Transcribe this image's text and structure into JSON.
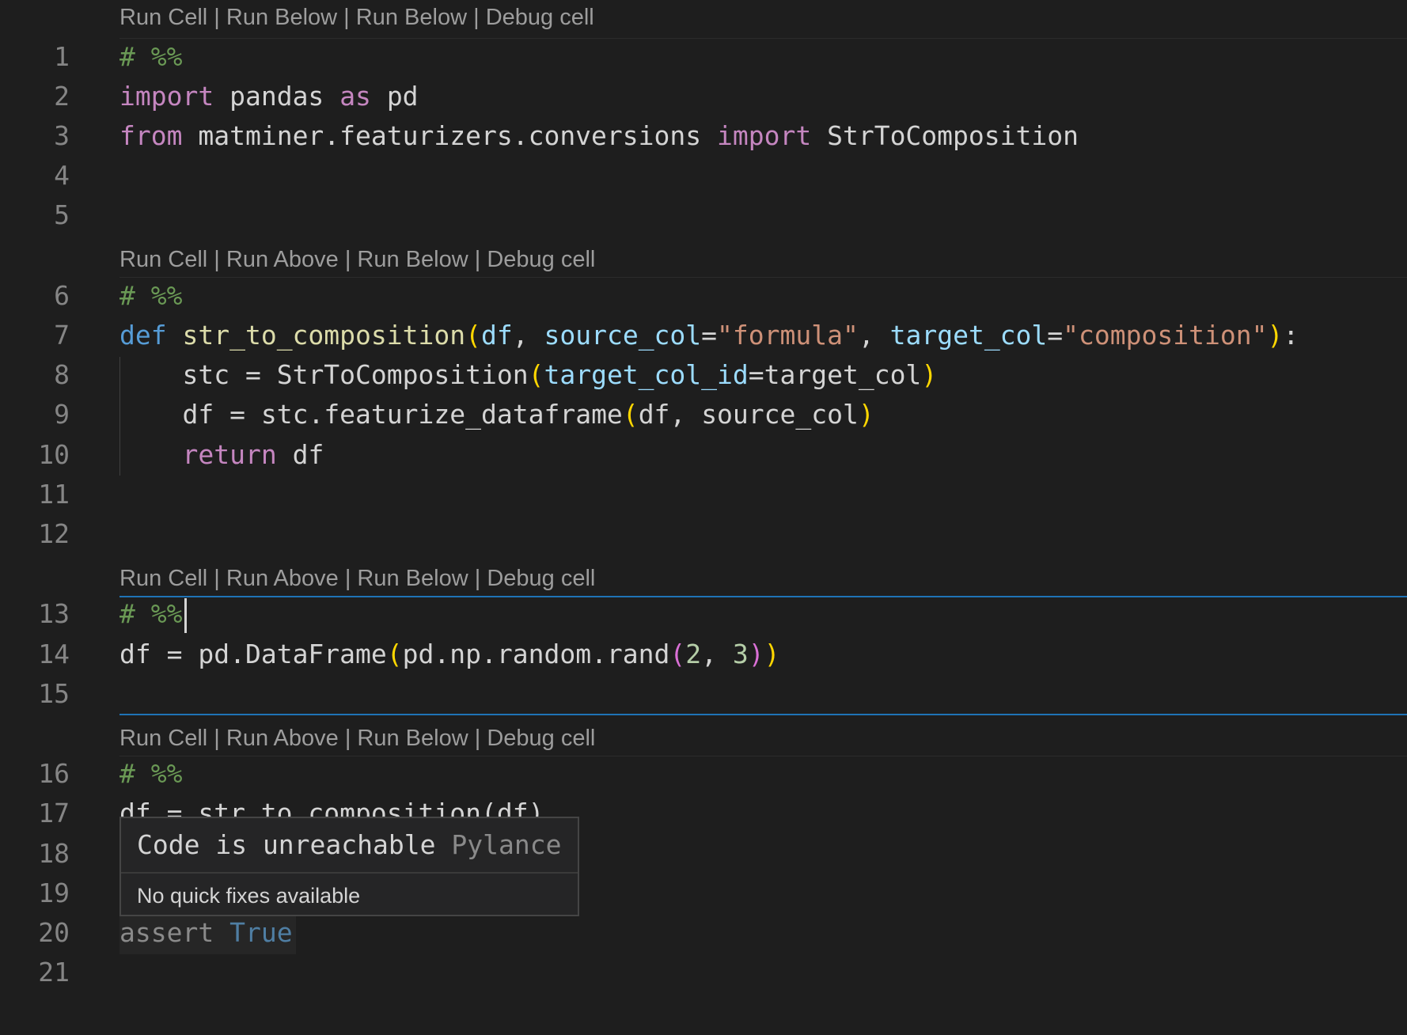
{
  "codelens": [
    {
      "items": [
        "Run Cell",
        "Run Below",
        "Run Below",
        "Debug cell"
      ]
    },
    {
      "items": [
        "Run Cell",
        "Run Above",
        "Run Below",
        "Debug cell"
      ]
    },
    {
      "items": [
        "Run Cell",
        "Run Above",
        "Run Below",
        "Debug cell"
      ]
    },
    {
      "items": [
        "Run Cell",
        "Run Above",
        "Run Below",
        "Debug cell"
      ]
    }
  ],
  "codelens_separator": " | ",
  "line_numbers": [
    "1",
    "2",
    "3",
    "4",
    "5",
    "6",
    "7",
    "8",
    "9",
    "10",
    "11",
    "12",
    "13",
    "14",
    "15",
    "16",
    "17",
    "18",
    "19",
    "20",
    "21"
  ],
  "code": {
    "l1": "# %%",
    "l2": {
      "kw1": "import",
      "mod": "pandas",
      "kw2": "as",
      "alias": "pd"
    },
    "l3": {
      "kw1": "from",
      "mod": "matminer.featurizers.conversions",
      "kw2": "import",
      "name": "StrToComposition"
    },
    "l6": "# %%",
    "l7": {
      "def": "def",
      "fname": "str_to_composition",
      "p1": "df",
      "p2": "source_col",
      "v2": "\"formula\"",
      "p3": "target_col",
      "v3": "\"composition\""
    },
    "l8": {
      "var": "stc",
      "cls": "StrToComposition",
      "kw": "target_col_id",
      "val": "target_col"
    },
    "l9": {
      "var": "df",
      "call": "stc.featurize_dataframe",
      "a1": "df",
      "a2": "source_col"
    },
    "l10": {
      "kw": "return",
      "val": "df"
    },
    "l13": "# %%",
    "l14": {
      "var": "df",
      "call": "pd.DataFrame",
      "inner": "pd.np.random.rand",
      "n1": "2",
      "n2": "3"
    },
    "l16": "# %%",
    "l17": "df = str_to_composition(df)",
    "l20": {
      "kw": "assert",
      "val": "True"
    }
  },
  "hover": {
    "message": "Code is unreachable",
    "source": "Pylance",
    "quick_fix": "No quick fixes available"
  },
  "colors": {
    "background": "#1e1e1e",
    "active_cell_border": "#1f73b6",
    "keyword": "#c586c0",
    "string": "#ce9178",
    "function": "#dcdcaa",
    "parameter": "#9cdcfe",
    "comment": "#6a9955"
  }
}
